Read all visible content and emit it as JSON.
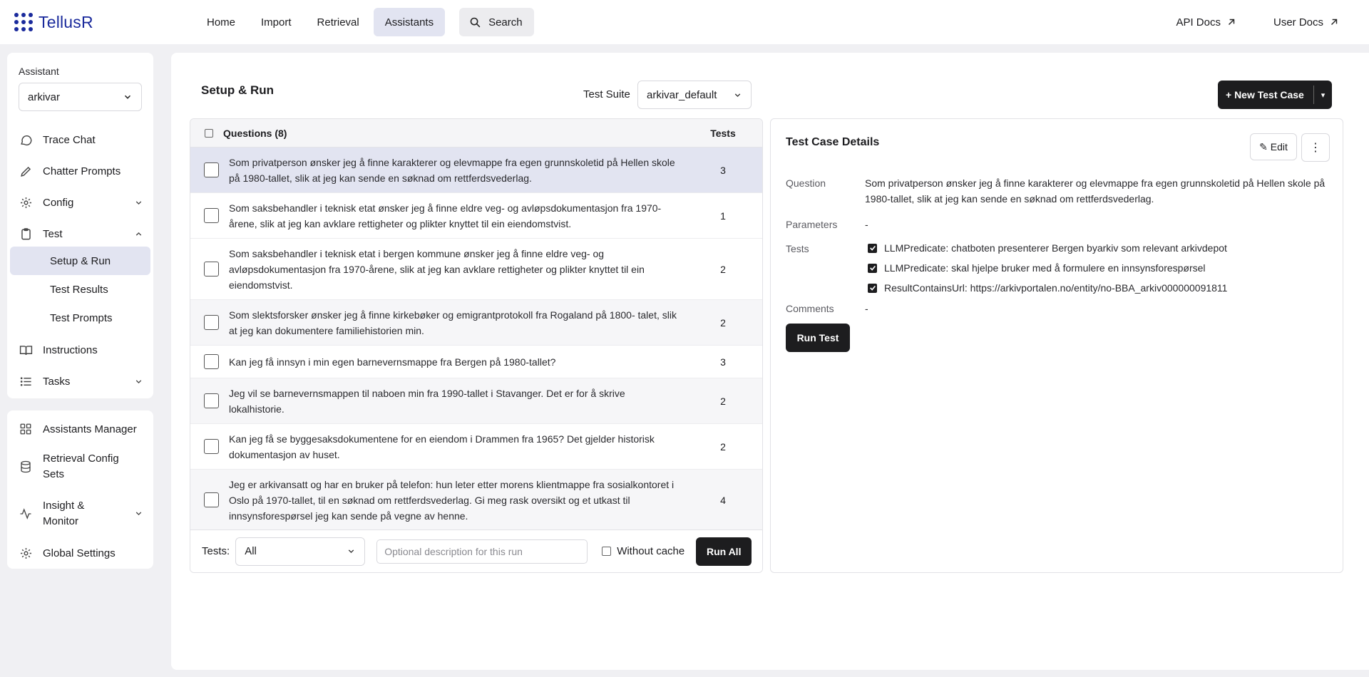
{
  "brand": {
    "name": "TellusR"
  },
  "nav": {
    "items": [
      {
        "label": "Home"
      },
      {
        "label": "Import"
      },
      {
        "label": "Retrieval"
      },
      {
        "label": "Assistants"
      }
    ],
    "search_label": "Search",
    "api_docs": "API Docs",
    "user_docs": "User Docs"
  },
  "sidebar": {
    "assistant_label": "Assistant",
    "assistant_value": "arkivar",
    "items": {
      "trace_chat": "Trace Chat",
      "chatter_prompts": "Chatter Prompts",
      "config": "Config",
      "test": "Test",
      "setup_run": "Setup & Run",
      "test_results": "Test Results",
      "test_prompts": "Test Prompts",
      "instructions": "Instructions",
      "tasks": "Tasks"
    },
    "lower": {
      "assistants_manager": "Assistants Manager",
      "retrieval_config_1": "Retrieval Config",
      "retrieval_config_2": "Sets",
      "insight_1": "Insight &",
      "insight_2": "Monitor",
      "global_settings": "Global Settings"
    }
  },
  "main": {
    "title": "Setup & Run",
    "suite_label": "Test Suite",
    "suite_value": "arkivar_default",
    "new_button": "+ New Test Case",
    "new_dropdown": "▾"
  },
  "questions": {
    "header": "Questions (8)",
    "tests_header": "Tests",
    "rows": [
      {
        "text": "Som privatperson ønsker jeg å finne karakterer og elevmappe fra egen grunnskoletid på Hellen skole på 1980-tallet, slik at jeg kan sende en søknad om rettferdsvederlag.",
        "tests": "3"
      },
      {
        "text": "Som saksbehandler i teknisk etat ønsker jeg å finne eldre veg- og avløpsdokumentasjon fra 1970-årene, slik at jeg kan avklare rettigheter og plikter knyttet til ein eiendomstvist.",
        "tests": "1"
      },
      {
        "text": "Som saksbehandler i teknisk etat i bergen kommune ønsker jeg å finne eldre veg- og avløpsdokumentasjon fra 1970-årene, slik at jeg kan avklare rettigheter og plikter knyttet til ein eiendomstvist.",
        "tests": "2"
      },
      {
        "text": "Som slektsforsker ønsker jeg å finne kirkebøker og emigrantprotokoll fra Rogaland på 1800- talet, slik at jeg kan dokumentere familiehistorien min.",
        "tests": "2"
      },
      {
        "text": "Kan jeg få innsyn i min egen barnevernsmappe fra Bergen på 1980-tallet?",
        "tests": "3"
      },
      {
        "text": "Jeg vil se barnevernsmappen til naboen min fra 1990-tallet i Stavanger. Det er for å skrive lokalhistorie.",
        "tests": "2"
      },
      {
        "text": "Kan jeg få se byggesaksdokumentene for en eiendom i Drammen fra 1965? Det gjelder historisk dokumentasjon av huset.",
        "tests": "2"
      },
      {
        "text": "Jeg er arkivansatt og har en bruker på telefon: hun leter etter morens klientmappe fra sosialkontoret i Oslo på 1970-tallet, til en søknad om rettferdsvederlag. Gi meg rask oversikt og et utkast til innsynsforespørsel jeg kan sende på vegne av henne.",
        "tests": "4"
      }
    ],
    "footer": {
      "tests_label": "Tests:",
      "tests_value": "All",
      "desc_placeholder": "Optional description for this run",
      "without_cache": "Without cache",
      "run_all": "Run All"
    }
  },
  "details": {
    "title": "Test Case Details",
    "edit": "✎ Edit",
    "more": "⋮",
    "question_label": "Question",
    "question_value": "Som privatperson ønsker jeg å finne karakterer og elevmappe fra egen grunnskoletid på Hellen skole på 1980-tallet, slik at jeg kan sende en søknad om rettferdsvederlag.",
    "parameters_label": "Parameters",
    "parameters_value": "-",
    "tests_label": "Tests",
    "tests": [
      "LLMPredicate: chatboten presenterer Bergen byarkiv som relevant arkivdepot",
      "LLMPredicate: skal hjelpe bruker med å formulere en innsynsforespørsel",
      "ResultContainsUrl: https://arkivportalen.no/entity/no-BBA_arkiv000000091811"
    ],
    "comments_label": "Comments",
    "comments_value": "-",
    "run_test": "Run Test"
  }
}
